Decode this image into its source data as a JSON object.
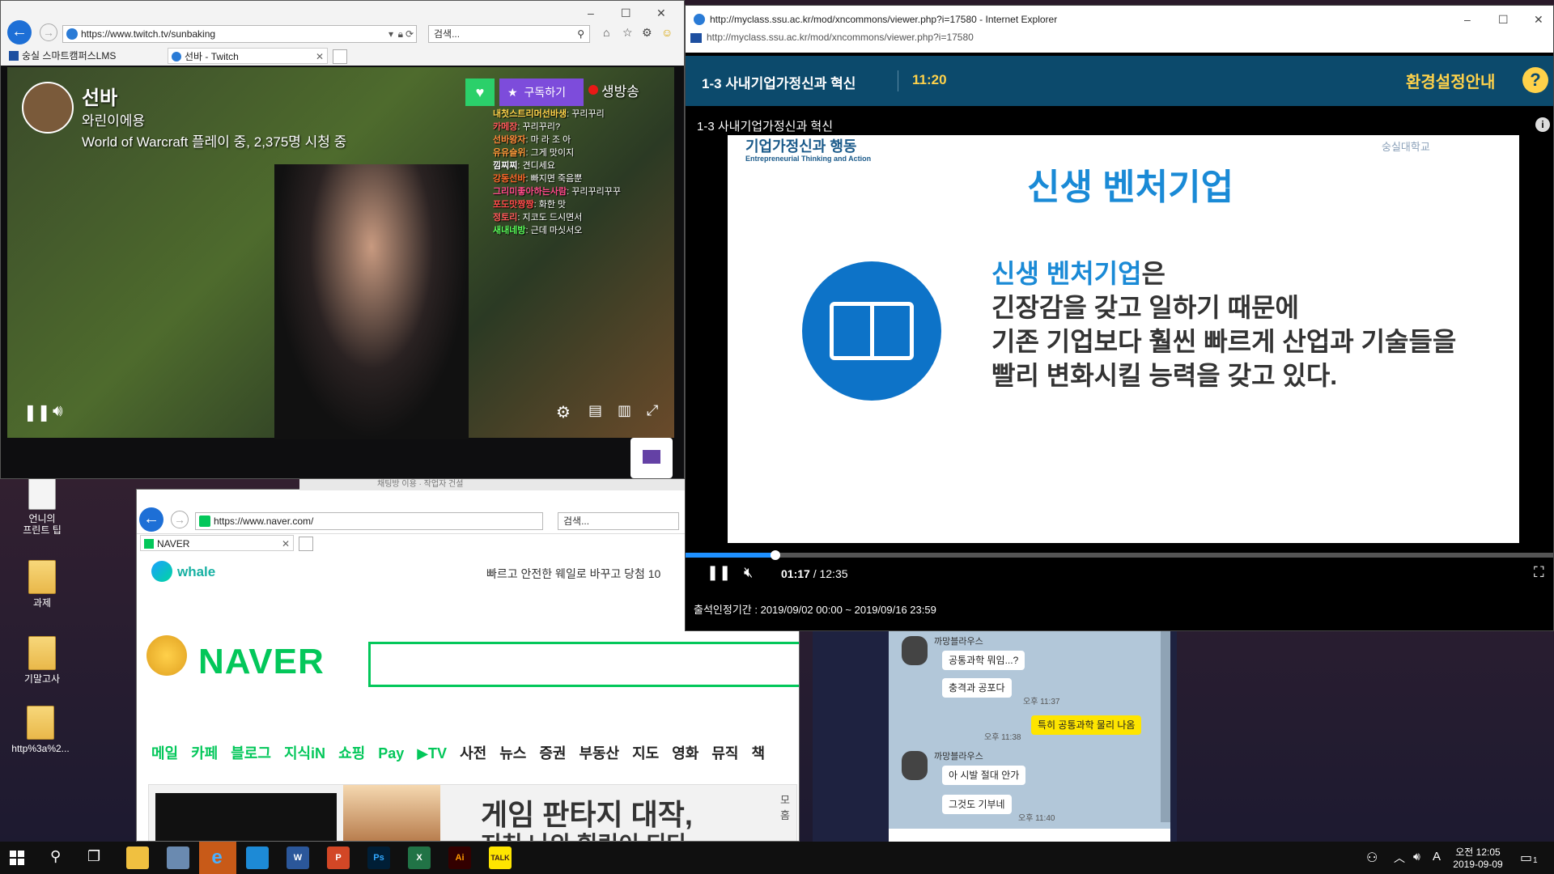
{
  "desktop": {
    "icons": [
      {
        "label": "언니의\n프린트 팁",
        "type": "doc"
      },
      {
        "label": "과제",
        "type": "folder"
      },
      {
        "label": "기말고사",
        "type": "folder"
      },
      {
        "label": "http%3a%2...",
        "type": "folder"
      }
    ]
  },
  "twitch_window": {
    "url": "https://www.twitch.tv/sunbaking",
    "search_placeholder": "검색...",
    "tabs": [
      "숭실 스마트캠퍼스LMS",
      "선바 - Twitch"
    ],
    "streamer_name": "선바",
    "stream_title": "와린이에용",
    "stream_info": "World of Warcraft 플레이 중, 2,375명 시청 중",
    "subscribe_label": "구독하기",
    "live_label": "생방송",
    "chat": [
      {
        "user": "내첫스트리머선바생",
        "msg": "꾸리꾸리",
        "color": "#ffd24a"
      },
      {
        "user": "카메장",
        "msg": "꾸리꾸리?",
        "color": "#ff5a5a"
      },
      {
        "user": "선바왕자",
        "msg": "마 라 조 아",
        "color": "#ff8a3a"
      },
      {
        "user": "유유슬위",
        "msg": "그게 맛이지",
        "color": "#ff9a3a"
      },
      {
        "user": "낌찌찌",
        "msg": "견디세요",
        "color": "#ffffff"
      },
      {
        "user": "강동선바",
        "msg": "빠지면 죽음뿐",
        "color": "#ff6a2a"
      },
      {
        "user": "그리미좋아하는사람",
        "msg": "꾸리꾸리꾸꾸",
        "color": "#ff4a8a"
      },
      {
        "user": "포도맛짱짱",
        "msg": "화한 맛",
        "color": "#ff4a4a"
      },
      {
        "user": "정토리",
        "msg": "지코도 드시면서",
        "color": "#ff5a5a"
      },
      {
        "user": "새내네방",
        "msg": "근데 마싯서오",
        "color": "#5aff5a"
      }
    ],
    "chat_header": "채팅방 이용 · 작업자 건설"
  },
  "naver_window": {
    "url": "https://www.naver.com/",
    "search_placeholder": "검색...",
    "tab": "NAVER",
    "whale_label": "whale",
    "whale_promo": "빠르고 안전한 웨일로 바꾸고 당첨 10",
    "logo": "NAVER",
    "menu": [
      "메일",
      "카페",
      "블로그",
      "지식iN",
      "쇼핑",
      "Pay",
      "▶TV",
      "사전",
      "뉴스",
      "증권",
      "부동산",
      "지도",
      "영화",
      "뮤직",
      "책"
    ],
    "ad_text": "게임 판타지 대작,",
    "ad_text2": "지친 나의 힐링이 되다",
    "more_label": "모 홈"
  },
  "lms_window": {
    "title": "http://myclass.ssu.ac.kr/mod/xncommons/viewer.php?i=17580 - Internet Explorer",
    "url": "http://myclass.ssu.ac.kr/mod/xncommons/viewer.php?i=17580",
    "lecture_title": "1-3 사내기업가정신과 혁신",
    "lecture_length": "11:20",
    "settings_label": "환경설정안내",
    "help_label": "?",
    "slide_caption": "1-3 사내기업가정신과 혁신",
    "slide_brand": "기업가정신과 행동",
    "slide_brand_en": "Entrepreneurial Thinking and Action",
    "university": "숭실대학교",
    "slide_heading": "신생 벤처기업",
    "slide_body": [
      "신생 벤처기업은",
      "긴장감을 갖고 일하기 때문에",
      "기존 기업보다 훨씬 빠르게 산업과 기술들을",
      "빨리 변화시킬 능력을 갖고 있다."
    ],
    "slide_body_highlight": "신생 벤처기업",
    "current_time": "01:17",
    "total_time": "12:35",
    "progress": 0.103,
    "attendance": "출석인정기간 : 2019/09/02 00:00 ~ 2019/09/16 23:59"
  },
  "kakao": {
    "messages": [
      {
        "from": "까망블라우스",
        "text": "공통과학 뭐임...?",
        "me": false
      },
      {
        "from": "",
        "text": "충격과 공포다",
        "me": false,
        "time": "오후 11:37"
      },
      {
        "from": "",
        "text": "특히 공통과학 물리 나옴",
        "me": true,
        "time": "오후 11:38"
      },
      {
        "from": "까망블라우스",
        "text": "아 시발 절대 안가",
        "me": false
      },
      {
        "from": "",
        "text": "그것도 기부네",
        "me": false,
        "time": "오후 11:40"
      }
    ]
  },
  "taskbar": {
    "apps": [
      "start",
      "search",
      "task-view",
      "explorer",
      "pc",
      "internet-explorer",
      "ssu",
      "word",
      "powerpoint",
      "photoshop",
      "excel",
      "illustrator",
      "kakaotalk"
    ],
    "time": "오전 12:05",
    "date": "2019-09-09",
    "ime": "A",
    "notification_count": "1"
  }
}
